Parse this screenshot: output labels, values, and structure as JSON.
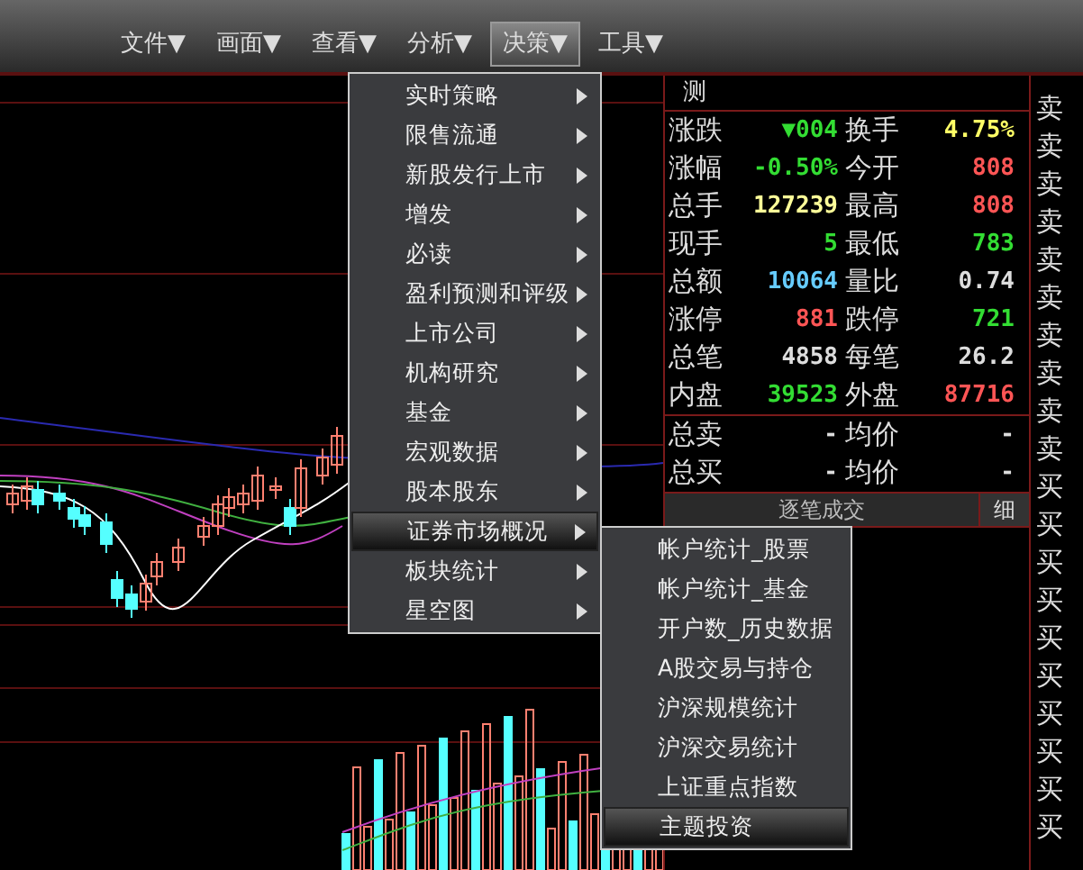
{
  "menubar": [
    {
      "label": "文件▼",
      "selected": false
    },
    {
      "label": "画面▼",
      "selected": false
    },
    {
      "label": "查看▼",
      "selected": false
    },
    {
      "label": "分析▼",
      "selected": false
    },
    {
      "label": "决策▼",
      "selected": true
    },
    {
      "label": "工具▼",
      "selected": false
    }
  ],
  "decision_menu": [
    {
      "label": "实时策略",
      "selected": false
    },
    {
      "label": "限售流通",
      "selected": false
    },
    {
      "label": "新股发行上市",
      "selected": false
    },
    {
      "label": "增发",
      "selected": false
    },
    {
      "label": "必读",
      "selected": false
    },
    {
      "label": "盈利预测和评级",
      "selected": false
    },
    {
      "label": "上市公司",
      "selected": false
    },
    {
      "label": "机构研究",
      "selected": false
    },
    {
      "label": "基金",
      "selected": false
    },
    {
      "label": "宏观数据",
      "selected": false
    },
    {
      "label": "股本股东",
      "selected": false
    },
    {
      "label": "证券市场概况",
      "selected": true
    },
    {
      "label": "板块统计",
      "selected": false
    },
    {
      "label": "星空图",
      "selected": false
    }
  ],
  "submenu": [
    {
      "label": "帐户统计_股票",
      "selected": false
    },
    {
      "label": "帐户统计_基金",
      "selected": false
    },
    {
      "label": "开户数_历史数据",
      "selected": false
    },
    {
      "label": "A股交易与持仓",
      "selected": false
    },
    {
      "label": "沪深规模统计",
      "selected": false
    },
    {
      "label": "沪深交易统计",
      "selected": false
    },
    {
      "label": "上证重点指数",
      "selected": false
    },
    {
      "label": "主题投资",
      "selected": true
    }
  ],
  "quote_tab": "测",
  "quote_rows": [
    [
      {
        "label": "涨跌",
        "value": "▼004",
        "color": "#33dd33"
      },
      {
        "label": "换手",
        "value": "4.75%",
        "color": "#ffff66"
      }
    ],
    [
      {
        "label": "涨幅",
        "value": "-0.50%",
        "color": "#33dd33"
      },
      {
        "label": "今开",
        "value": "808",
        "color": "#ff5555"
      }
    ],
    [
      {
        "label": "总手",
        "value": "127239",
        "color": "#ffff99"
      },
      {
        "label": "最高",
        "value": "808",
        "color": "#ff5555"
      }
    ],
    [
      {
        "label": "现手",
        "value": "5",
        "color": "#33dd33"
      },
      {
        "label": "最低",
        "value": "783",
        "color": "#33dd33"
      }
    ],
    [
      {
        "label": "总额",
        "value": "10064",
        "color": "#66ccff"
      },
      {
        "label": "量比",
        "value": "0.74",
        "color": "#dddddd"
      }
    ],
    [
      {
        "label": "涨停",
        "value": "881",
        "color": "#ff5555"
      },
      {
        "label": "跌停",
        "value": "721",
        "color": "#33dd33"
      }
    ],
    [
      {
        "label": "总笔",
        "value": "4858",
        "color": "#dddddd"
      },
      {
        "label": "每笔",
        "value": "26.2",
        "color": "#dddddd"
      }
    ],
    [
      {
        "label": "内盘",
        "value": "39523",
        "color": "#33dd33"
      },
      {
        "label": "外盘",
        "value": "87716",
        "color": "#ff5555"
      }
    ]
  ],
  "totals": [
    {
      "label": "总卖",
      "value": "-",
      "label_2": "均价",
      "value_2": "-"
    },
    {
      "label": "总买",
      "value": "-",
      "label_2": "均价",
      "value_2": "-"
    }
  ],
  "trades_header": {
    "title": "逐笔成交",
    "button": "细"
  },
  "order_book": [
    "卖",
    "卖",
    "卖",
    "卖",
    "卖",
    "卖",
    "卖",
    "卖",
    "卖",
    "卖",
    "买",
    "买",
    "买",
    "买",
    "买",
    "买",
    "买",
    "买",
    "买",
    "买"
  ]
}
